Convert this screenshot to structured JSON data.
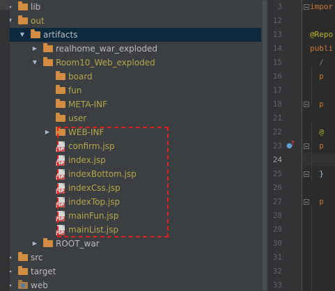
{
  "project_tree": {
    "items": [
      {
        "label": "lib",
        "kind": "folder",
        "expanded": false,
        "style": "normal"
      },
      {
        "label": "out",
        "kind": "folder",
        "expanded": true,
        "style": "excluded"
      },
      {
        "label": "artifacts",
        "kind": "folder",
        "expanded": true,
        "style": "normal",
        "selected": true
      },
      {
        "label": "realhome_war_exploded",
        "kind": "folder",
        "expanded": false,
        "style": "normal"
      },
      {
        "label": "Room10_Web_exploded",
        "kind": "folder",
        "expanded": true,
        "style": "excluded"
      },
      {
        "label": "board",
        "kind": "folder",
        "style": "excluded"
      },
      {
        "label": "fun",
        "kind": "folder",
        "style": "excluded"
      },
      {
        "label": "META-INF",
        "kind": "folder",
        "style": "excluded"
      },
      {
        "label": "user",
        "kind": "folder",
        "style": "excluded"
      },
      {
        "label": "WEB-INF",
        "kind": "folder",
        "expanded": false,
        "style": "excluded"
      },
      {
        "label": "confirm.jsp",
        "kind": "jsp",
        "style": "excluded"
      },
      {
        "label": "index.jsp",
        "kind": "jsp",
        "style": "excluded"
      },
      {
        "label": "indexBottom.jsp",
        "kind": "jsp",
        "style": "excluded"
      },
      {
        "label": "indexCss.jsp",
        "kind": "jsp",
        "style": "excluded"
      },
      {
        "label": "indexTop.jsp",
        "kind": "jsp",
        "style": "excluded"
      },
      {
        "label": "mainFun.jsp",
        "kind": "jsp",
        "style": "excluded"
      },
      {
        "label": "mainList.jsp",
        "kind": "jsp",
        "style": "excluded"
      },
      {
        "label": "ROOT_war",
        "kind": "folder",
        "expanded": false,
        "style": "normal"
      },
      {
        "label": "src",
        "kind": "folder",
        "expanded": false,
        "style": "normal"
      },
      {
        "label": "target",
        "kind": "folder",
        "expanded": false,
        "style": "normal"
      },
      {
        "label": "web",
        "kind": "folder",
        "expanded": false,
        "style": "normal",
        "module": true
      }
    ],
    "jsp_badge": "JSP"
  },
  "editor": {
    "lines": [
      {
        "num": "3",
        "code": [
          {
            "t": "impor",
            "c": "keyword"
          }
        ],
        "fold": true
      },
      {
        "num": "12",
        "code": []
      },
      {
        "num": "13",
        "code": [
          {
            "t": "@Repo",
            "c": "annotation"
          }
        ]
      },
      {
        "num": "14",
        "code": [
          {
            "t": "publi",
            "c": "keyword"
          }
        ]
      },
      {
        "num": "15",
        "code": [
          {
            "t": "  /",
            "c": "comment"
          }
        ]
      },
      {
        "num": "16",
        "code": [
          {
            "t": "  p",
            "c": "keyword"
          }
        ]
      },
      {
        "num": "17",
        "code": []
      },
      {
        "num": "18",
        "code": [
          {
            "t": "  p",
            "c": "keyword"
          }
        ],
        "fold": true
      },
      {
        "num": "21",
        "code": []
      },
      {
        "num": "22",
        "code": [
          {
            "t": "  @",
            "c": "annotation"
          }
        ]
      },
      {
        "num": "23",
        "code": [
          {
            "t": "  p",
            "c": "keyword"
          }
        ],
        "fold": true,
        "gutter_icon": "implements-icon"
      },
      {
        "num": "24",
        "code": [],
        "current": true
      },
      {
        "num": "25",
        "code": [
          {
            "t": "  }",
            "c": "plain"
          }
        ],
        "fold": true
      },
      {
        "num": "26",
        "code": []
      },
      {
        "num": "27",
        "code": [
          {
            "t": "  p",
            "c": "keyword"
          }
        ],
        "fold": true
      },
      {
        "num": "28",
        "code": []
      },
      {
        "num": "29",
        "code": []
      },
      {
        "num": "30",
        "code": []
      },
      {
        "num": "31",
        "code": []
      },
      {
        "num": "32",
        "code": []
      },
      {
        "num": "33",
        "code": []
      }
    ],
    "colors": {
      "keyword": "#cc7832",
      "annotation": "#bbb529",
      "comment": "#808080",
      "plain": "#a9b7c6"
    }
  }
}
